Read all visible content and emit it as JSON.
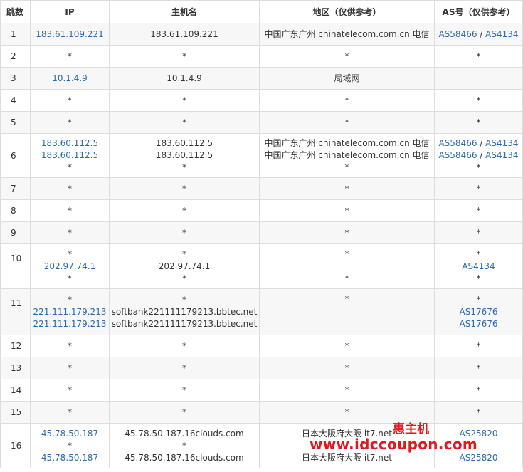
{
  "headers": {
    "hop": "跳数",
    "ip": "IP",
    "host": "主机名",
    "region": "地区（仅供参考）",
    "as": "AS号（仅供参考）"
  },
  "rows": [
    {
      "hop": "1",
      "ip": [
        "183.61.109.221"
      ],
      "host": [
        "183.61.109.221"
      ],
      "region": [
        "中国广东广州 chinatelecom.com.cn 电信"
      ],
      "as": [
        [
          "AS58466",
          "AS4134"
        ]
      ]
    },
    {
      "hop": "2",
      "ip": [
        "*"
      ],
      "host": [
        "*"
      ],
      "region": [
        "*"
      ],
      "as": [
        [
          "*"
        ]
      ]
    },
    {
      "hop": "3",
      "ip": [
        "10.1.4.9"
      ],
      "host": [
        "10.1.4.9"
      ],
      "region": [
        "局域网"
      ],
      "as": []
    },
    {
      "hop": "4",
      "ip": [
        "*"
      ],
      "host": [
        "*"
      ],
      "region": [
        "*"
      ],
      "as": [
        [
          "*"
        ]
      ]
    },
    {
      "hop": "5",
      "ip": [
        "*"
      ],
      "host": [
        "*"
      ],
      "region": [
        "*"
      ],
      "as": [
        [
          "*"
        ]
      ]
    },
    {
      "hop": "6",
      "ip": [
        "183.60.112.5",
        "183.60.112.5",
        "*"
      ],
      "host": [
        "183.60.112.5",
        "183.60.112.5",
        "*"
      ],
      "region": [
        "中国广东广州 chinatelecom.com.cn 电信",
        "中国广东广州 chinatelecom.com.cn 电信",
        "*"
      ],
      "as": [
        [
          "AS58466",
          "AS4134"
        ],
        [
          "AS58466",
          "AS4134"
        ],
        [
          "*"
        ]
      ]
    },
    {
      "hop": "7",
      "ip": [
        "*"
      ],
      "host": [
        "*"
      ],
      "region": [
        "*"
      ],
      "as": [
        [
          "*"
        ]
      ]
    },
    {
      "hop": "8",
      "ip": [
        "*"
      ],
      "host": [
        "*"
      ],
      "region": [
        "*"
      ],
      "as": [
        [
          "*"
        ]
      ]
    },
    {
      "hop": "9",
      "ip": [
        "*"
      ],
      "host": [
        "*"
      ],
      "region": [
        "*"
      ],
      "as": [
        [
          "*"
        ]
      ]
    },
    {
      "hop": "10",
      "ip": [
        "*",
        "202.97.74.1",
        "*"
      ],
      "host": [
        "*",
        "202.97.74.1",
        "*"
      ],
      "region": [
        "*",
        "",
        "*"
      ],
      "as": [
        [
          "*"
        ],
        [
          "AS4134"
        ],
        [
          "*"
        ]
      ]
    },
    {
      "hop": "11",
      "ip": [
        "*",
        "221.111.179.213",
        "221.111.179.213"
      ],
      "host": [
        "*",
        "softbank221111179213.bbtec.net",
        "softbank221111179213.bbtec.net"
      ],
      "region": [
        "*"
      ],
      "as": [
        [
          "*"
        ],
        [
          "AS17676"
        ],
        [
          "AS17676"
        ]
      ]
    },
    {
      "hop": "12",
      "ip": [
        "*"
      ],
      "host": [
        "*"
      ],
      "region": [
        "*"
      ],
      "as": [
        [
          "*"
        ]
      ]
    },
    {
      "hop": "13",
      "ip": [
        "*"
      ],
      "host": [
        "*"
      ],
      "region": [
        "*"
      ],
      "as": [
        [
          "*"
        ]
      ]
    },
    {
      "hop": "14",
      "ip": [
        "*"
      ],
      "host": [
        "*"
      ],
      "region": [
        "*"
      ],
      "as": [
        [
          "*"
        ]
      ]
    },
    {
      "hop": "15",
      "ip": [
        "*"
      ],
      "host": [
        "*"
      ],
      "region": [
        "*"
      ],
      "as": [
        [
          "*"
        ]
      ]
    },
    {
      "hop": "16",
      "ip": [
        "45.78.50.187",
        "*",
        "45.78.50.187"
      ],
      "host": [
        "45.78.50.187.16clouds.com",
        "*",
        "45.78.50.187.16clouds.com"
      ],
      "region": [
        "日本大阪府大阪 it7.net",
        "",
        "日本大阪府大阪 it7.net"
      ],
      "as": [
        [
          "AS25820"
        ],
        [
          ""
        ],
        [
          "AS25820"
        ]
      ]
    }
  ],
  "watermark": {
    "brand": "惠主机",
    "url": "www.idccoupon.com"
  }
}
